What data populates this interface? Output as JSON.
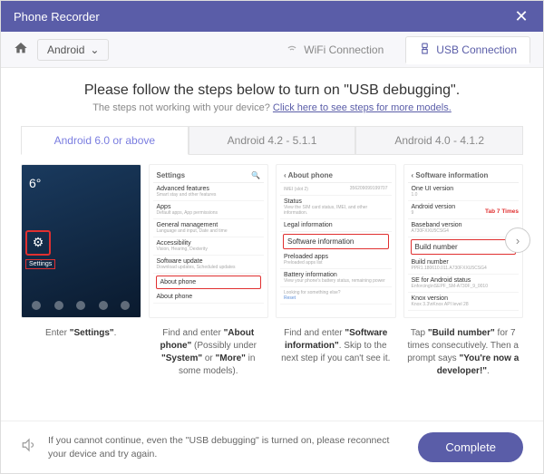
{
  "window": {
    "title": "Phone Recorder"
  },
  "toolbar": {
    "device": "Android"
  },
  "connections": {
    "wifi": "WiFi Connection",
    "usb": "USB Connection"
  },
  "headline": "Please follow the steps below to turn on \"USB debugging\".",
  "subline_prefix": "The steps not working with your device? ",
  "subline_link": "Click here to see steps for more models.",
  "tabs": {
    "a": "Android 6.0 or above",
    "b": "Android 4.2 - 5.1.1",
    "c": "Android 4.0 - 4.1.2"
  },
  "steps": {
    "s1": {
      "label": "Settings",
      "caption_pre": "Enter ",
      "caption_b": "\"Settings\"",
      "caption_post": "."
    },
    "s2": {
      "header": "Settings",
      "rows": [
        {
          "t": "Advanced features",
          "s": "Smart stay and other features"
        },
        {
          "t": "Apps",
          "s": "Default apps, App permissions"
        },
        {
          "t": "General management",
          "s": "Language and input, Date and time"
        },
        {
          "t": "Accessibility",
          "s": "Vision, Hearing, Dexterity"
        },
        {
          "t": "Software update",
          "s": "Download updates, Scheduled updates"
        }
      ],
      "boxed": "About phone",
      "after": "About phone",
      "caption_p1": "Find and enter ",
      "caption_b1": "\"About phone\"",
      "caption_p2": " (Possibly under ",
      "caption_b2": "\"System\"",
      "caption_p3": " or ",
      "caption_b3": "\"More\"",
      "caption_p4": " in some models)."
    },
    "s3": {
      "header": "About phone",
      "top_a": "IMEI (slot 2)",
      "top_b": "356209099199707",
      "row1": {
        "t": "Status",
        "s": "View the SIM card status, IMEI, and other information."
      },
      "row2": "Legal information",
      "boxed": "Software information",
      "row3": {
        "t": "Preloaded apps",
        "s": "Preloaded apps list"
      },
      "row4": {
        "t": "Battery information",
        "s": "View your phone's battery status, remaining power"
      },
      "row5": "Looking for something else?",
      "reset": "Reset",
      "caption_p1": "Find and enter ",
      "caption_b1": "\"Software information\"",
      "caption_p2": ". Skip to the next step if you can't see it."
    },
    "s4": {
      "header": "Software information",
      "row1": {
        "t": "One UI version",
        "s": "1.0"
      },
      "row2": {
        "t": "Android version",
        "s": "9"
      },
      "row3": {
        "t": "Baseband version",
        "s": "A730FXXU5CSG4"
      },
      "tag": "Tab 7 Times",
      "boxed": "Build number",
      "row4": {
        "t": "Build number",
        "s": "PPR1.180610.011.A730FXXU5CSG4"
      },
      "row5": {
        "t": "SE for Android status",
        "s": "Enforcing\\nSEPF_SM-A730F_9_0010"
      },
      "row6": {
        "t": "Knox version",
        "s": "Knox 3.3\\nKnox API level 28"
      },
      "caption_p1": "Tap ",
      "caption_b1": "\"Build number\"",
      "caption_p2": " for 7 times consecutively. Then a prompt says ",
      "caption_b2": "\"You're now a developer!\"",
      "caption_p3": "."
    }
  },
  "footer": {
    "note": "If you cannot continue, even the \"USB debugging\" is turned on, please reconnect your device and try again.",
    "button": "Complete"
  }
}
